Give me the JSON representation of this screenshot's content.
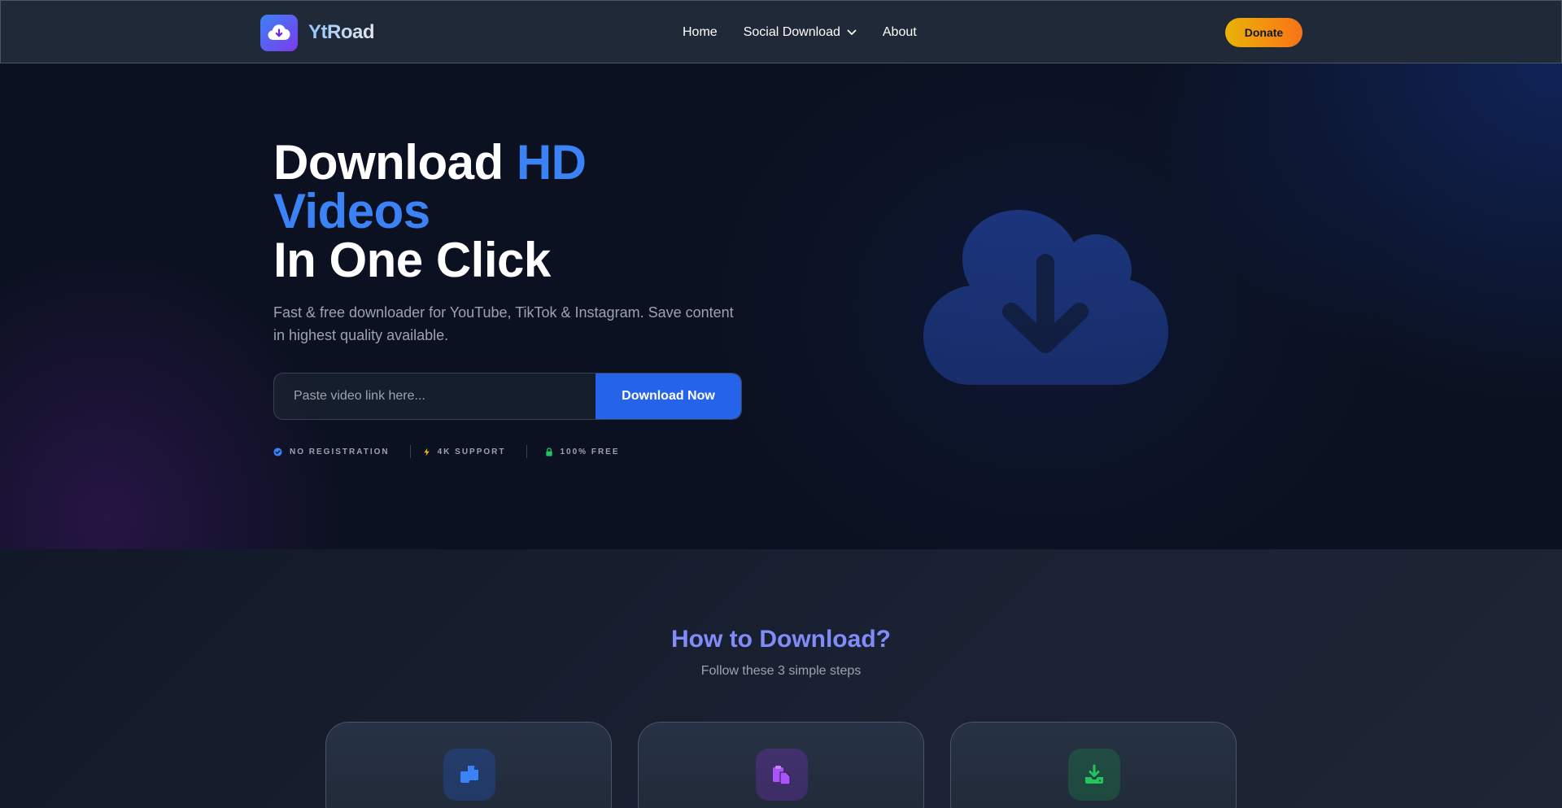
{
  "nav": {
    "brand_name": "YtRoad",
    "brand_icon": "cloud-download-icon",
    "links": [
      {
        "label": "Home"
      },
      {
        "label": "Social Download",
        "icon": "chevron-down-icon"
      },
      {
        "label": "About"
      }
    ],
    "donate_label": "Donate"
  },
  "hero": {
    "title_prefix": "Download ",
    "title_accent_1": "HD",
    "title_accent_2": "Videos",
    "title_line_3": "In One Click",
    "subtitle": "Fast & free downloader for YouTube, TikTok & Instagram. Save content in highest quality available.",
    "search_placeholder": "Paste video link here...",
    "search_value": "",
    "download_label": "Download Now",
    "features": [
      {
        "label": "NO REGISTRATION",
        "icon": "check-circle-icon",
        "color": "#3b82f6"
      },
      {
        "label": "4K SUPPORT",
        "icon": "bolt-icon",
        "color": "#eab308"
      },
      {
        "label": "100% FREE",
        "icon": "lock-icon",
        "color": "#22c55e"
      }
    ],
    "illustration_icon": "cloud-download-icon"
  },
  "howto": {
    "title": "How to Download?",
    "subtitle": "Follow these 3 simple steps",
    "steps": [
      {
        "icon": "copy-icon",
        "color": "#3b82f6"
      },
      {
        "icon": "paste-icon",
        "color": "#a855f7"
      },
      {
        "icon": "download-icon",
        "color": "#22c55e"
      }
    ]
  },
  "colors": {
    "accent": "#3b82f6",
    "primary_button": "#2563eb",
    "donate_gradient_start": "#eab308",
    "donate_gradient_end": "#f97316",
    "background": "#0b1120",
    "navbar": "#1f2937"
  }
}
